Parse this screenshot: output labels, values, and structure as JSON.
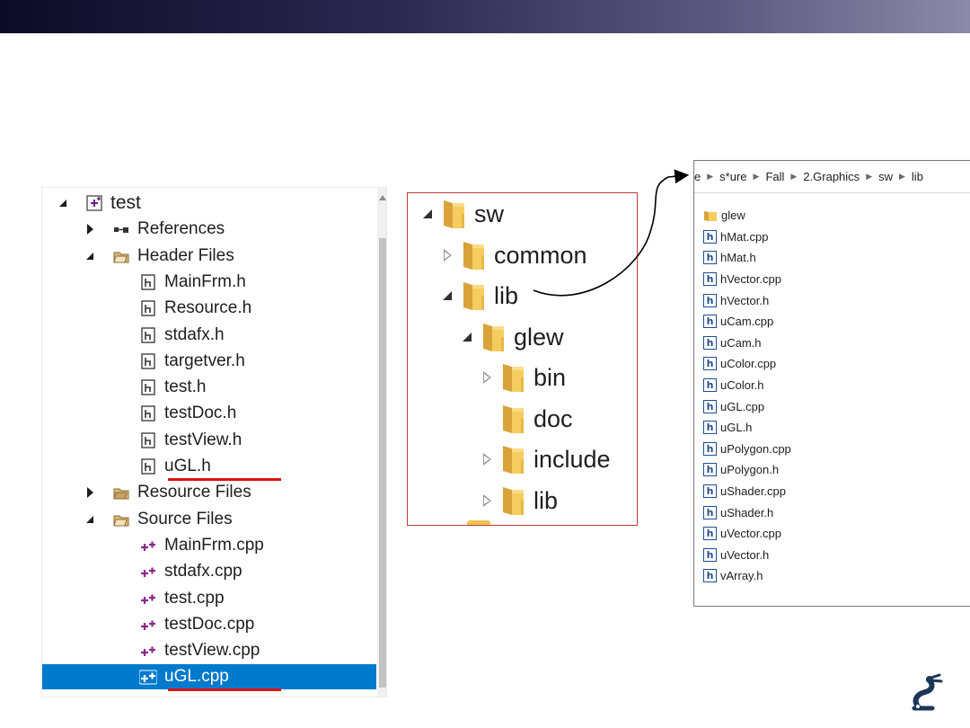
{
  "solution_explorer": {
    "rows": [
      {
        "label": "test",
        "kind": "project",
        "expander": "open",
        "indent": 0
      },
      {
        "label": "References",
        "kind": "references",
        "expander": "closed",
        "indent": 1
      },
      {
        "label": "Header Files",
        "kind": "filter",
        "expander": "open",
        "indent": 1
      },
      {
        "label": "MainFrm.h",
        "kind": "header",
        "expander": "none",
        "indent": 2
      },
      {
        "label": "Resource.h",
        "kind": "header",
        "expander": "none",
        "indent": 2
      },
      {
        "label": "stdafx.h",
        "kind": "header",
        "expander": "none",
        "indent": 2
      },
      {
        "label": "targetver.h",
        "kind": "header",
        "expander": "none",
        "indent": 2
      },
      {
        "label": "test.h",
        "kind": "header",
        "expander": "none",
        "indent": 2
      },
      {
        "label": "testDoc.h",
        "kind": "header",
        "expander": "none",
        "indent": 2
      },
      {
        "label": "testView.h",
        "kind": "header",
        "expander": "none",
        "indent": 2
      },
      {
        "label": "uGL.h",
        "kind": "header",
        "expander": "none",
        "indent": 2,
        "underlined": true
      },
      {
        "label": "Resource Files",
        "kind": "filter-closed",
        "expander": "closed",
        "indent": 1
      },
      {
        "label": "Source Files",
        "kind": "filter",
        "expander": "open",
        "indent": 1
      },
      {
        "label": "MainFrm.cpp",
        "kind": "cpp",
        "expander": "none",
        "indent": 2
      },
      {
        "label": "stdafx.cpp",
        "kind": "cpp",
        "expander": "none",
        "indent": 2
      },
      {
        "label": "test.cpp",
        "kind": "cpp",
        "expander": "none",
        "indent": 2
      },
      {
        "label": "testDoc.cpp",
        "kind": "cpp",
        "expander": "none",
        "indent": 2
      },
      {
        "label": "testView.cpp",
        "kind": "cpp",
        "expander": "none",
        "indent": 2
      },
      {
        "label": "uGL.cpp",
        "kind": "cpp-selected",
        "expander": "none",
        "indent": 2,
        "selected": true,
        "underlined": true
      }
    ]
  },
  "folder_tree": {
    "rows": [
      {
        "label": "sw",
        "expander": "open",
        "indent": 0
      },
      {
        "label": "common",
        "expander": "closed",
        "indent": 1
      },
      {
        "label": "lib",
        "expander": "open",
        "indent": 1
      },
      {
        "label": "glew",
        "expander": "open",
        "indent": 2
      },
      {
        "label": "bin",
        "expander": "closed",
        "indent": 3
      },
      {
        "label": "doc",
        "expander": "none",
        "indent": 3
      },
      {
        "label": "include",
        "expander": "closed",
        "indent": 3
      },
      {
        "label": "lib",
        "expander": "closed",
        "indent": 3
      }
    ]
  },
  "file_explorer": {
    "breadcrumb": [
      "e",
      "s*ure",
      "Fall",
      "2.Graphics",
      "sw",
      "lib"
    ],
    "items": [
      {
        "name": "glew",
        "type": "folder"
      },
      {
        "name": "hMat.cpp",
        "type": "file"
      },
      {
        "name": "hMat.h",
        "type": "file"
      },
      {
        "name": "hVector.cpp",
        "type": "file"
      },
      {
        "name": "hVector.h",
        "type": "file"
      },
      {
        "name": "uCam.cpp",
        "type": "file"
      },
      {
        "name": "uCam.h",
        "type": "file"
      },
      {
        "name": "uColor.cpp",
        "type": "file"
      },
      {
        "name": "uColor.h",
        "type": "file"
      },
      {
        "name": "uGL.cpp",
        "type": "file"
      },
      {
        "name": "uGL.h",
        "type": "file"
      },
      {
        "name": "uPolygon.cpp",
        "type": "file"
      },
      {
        "name": "uPolygon.h",
        "type": "file"
      },
      {
        "name": "uShader.cpp",
        "type": "file"
      },
      {
        "name": "uShader.h",
        "type": "file"
      },
      {
        "name": "uVector.cpp",
        "type": "file"
      },
      {
        "name": "uVector.h",
        "type": "file"
      },
      {
        "name": "vArray.h",
        "type": "file"
      }
    ]
  },
  "colors": {
    "selection": "#007acc",
    "highlight_line": "#e01010",
    "tree_border": "#c0393b",
    "folder": "#f2c24f"
  }
}
